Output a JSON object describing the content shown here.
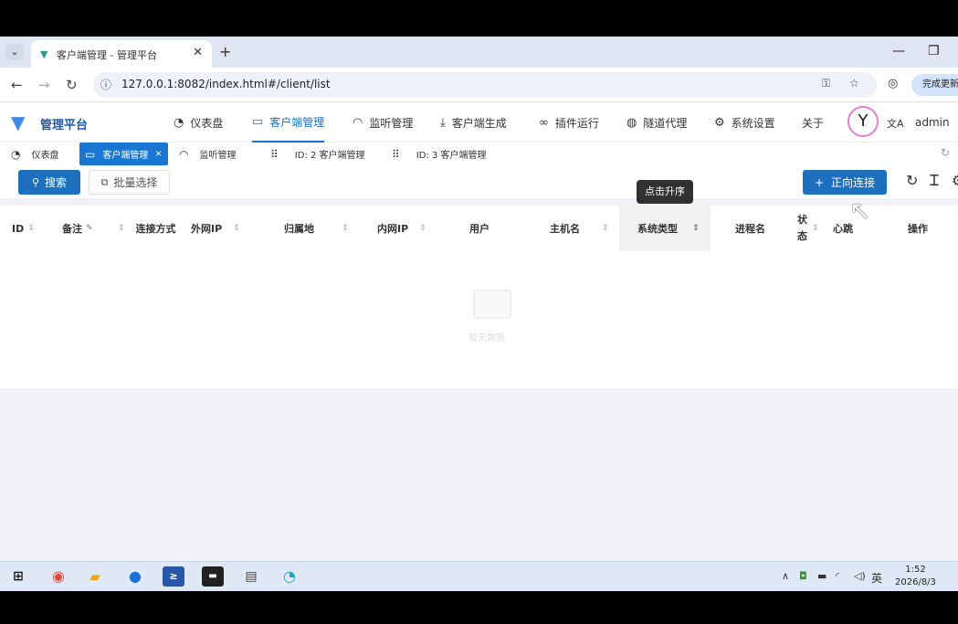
{
  "browser": {
    "tab_title": "客户端管理 - 管理平台",
    "url": "127.0.0.1:8082/index.html#/client/list",
    "update_label": "完成更新"
  },
  "app": {
    "title": "管理平台",
    "menu": [
      {
        "label": "仪表盘",
        "icon": "dashboard-icon"
      },
      {
        "label": "客户端管理",
        "icon": "monitor-icon"
      },
      {
        "label": "监听管理",
        "icon": "headphones-icon"
      },
      {
        "label": "客户端生成",
        "icon": "download-icon"
      },
      {
        "label": "插件运行",
        "icon": "link-icon"
      },
      {
        "label": "隧道代理",
        "icon": "globe-icon"
      },
      {
        "label": "系统设置",
        "icon": "gear-icon"
      },
      {
        "label": "关于",
        "icon": ""
      }
    ],
    "user": "admin",
    "tags": [
      {
        "label": "仪表盘"
      },
      {
        "label": "客户端管理"
      },
      {
        "label": "监听管理"
      },
      {
        "label": "ID: 2 客户端管理"
      },
      {
        "label": "ID: 3 客户端管理"
      }
    ]
  },
  "toolbar": {
    "search_label": "搜索",
    "batch_label": "批量选择",
    "connect_label": "正向连接"
  },
  "tooltip": "点击升序",
  "table": {
    "columns": [
      "ID",
      "备注",
      "连接方式",
      "外网IP",
      "归属地",
      "内网IP",
      "用户",
      "主机名",
      "系统类型",
      "进程名",
      "状态",
      "心跳",
      "操作"
    ],
    "empty_text": "暂无数据"
  },
  "taskbar": {
    "ime": "英",
    "time": "1:52",
    "date": "2026/8/3"
  },
  "colors": {
    "primary": "#1f6fbf",
    "tooltip_bg": "#303133"
  }
}
